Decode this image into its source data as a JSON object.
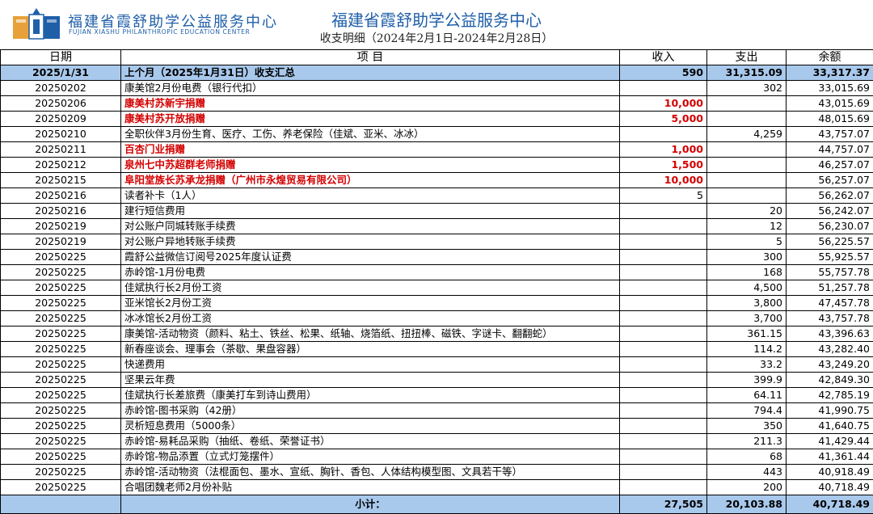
{
  "header": {
    "org_name_cn": "福建省霞舒助学公益服务中心",
    "org_name_en": "FUJIAN XIASHU PHILANTHROPIC EDUCATION CENTER",
    "title": "福建省霞舒助学公益服务中心",
    "subtitle": "收支明细（2024年2月1日-2024年2月28日）"
  },
  "table": {
    "columns": [
      "日期",
      "项  目",
      "收入",
      "支出",
      "余额"
    ],
    "summary": {
      "date": "2025/1/31",
      "item": "上个月（2025年1月31日）收支汇总",
      "income": "590",
      "expense": "31,315.09",
      "balance": "33,317.37"
    },
    "rows": [
      {
        "date": "20250202",
        "item": "康美馆2月份电费（银行代扣）",
        "income": "",
        "expense": "302",
        "balance": "33,015.69",
        "donation": false
      },
      {
        "date": "20250206",
        "item": "康美村苏新宇捐赠",
        "income": "10,000",
        "expense": "",
        "balance": "43,015.69",
        "donation": true
      },
      {
        "date": "20250209",
        "item": "康美村苏开放捐赠",
        "income": "5,000",
        "expense": "",
        "balance": "48,015.69",
        "donation": true
      },
      {
        "date": "20250210",
        "item": "全职伙伴3月份生育、医疗、工伤、养老保险（佳斌、亚米、冰冰）",
        "income": "",
        "expense": "4,259",
        "balance": "43,757.07",
        "donation": false
      },
      {
        "date": "20250211",
        "item": "百杏门业捐赠",
        "income": "1,000",
        "expense": "",
        "balance": "44,757.07",
        "donation": true
      },
      {
        "date": "20250212",
        "item": "泉州七中苏超群老师捐赠",
        "income": "1,500",
        "expense": "",
        "balance": "46,257.07",
        "donation": true
      },
      {
        "date": "20250215",
        "item": "阜阳堂族长苏承龙捐赠（广州市永煌贸易有限公司）",
        "income": "10,000",
        "expense": "",
        "balance": "56,257.07",
        "donation": true
      },
      {
        "date": "20250216",
        "item": "读者补卡（1人）",
        "income": "5",
        "expense": "",
        "balance": "56,262.07",
        "donation": false
      },
      {
        "date": "20250216",
        "item": "建行短信费用",
        "income": "",
        "expense": "20",
        "balance": "56,242.07",
        "donation": false
      },
      {
        "date": "20250219",
        "item": "对公账户同城转账手续费",
        "income": "",
        "expense": "12",
        "balance": "56,230.07",
        "donation": false
      },
      {
        "date": "20250219",
        "item": "对公账户异地转账手续费",
        "income": "",
        "expense": "5",
        "balance": "56,225.57",
        "donation": false
      },
      {
        "date": "20250225",
        "item": "霞舒公益微信订阅号2025年度认证费",
        "income": "",
        "expense": "300",
        "balance": "55,925.57",
        "donation": false
      },
      {
        "date": "20250225",
        "item": "赤岭馆-1月份电费",
        "income": "",
        "expense": "168",
        "balance": "55,757.78",
        "donation": false
      },
      {
        "date": "20250225",
        "item": "佳斌执行长2月份工资",
        "income": "",
        "expense": "4,500",
        "balance": "51,257.78",
        "donation": false
      },
      {
        "date": "20250225",
        "item": "亚米馆长2月份工资",
        "income": "",
        "expense": "3,800",
        "balance": "47,457.78",
        "donation": false
      },
      {
        "date": "20250225",
        "item": "冰冰馆长2月份工资",
        "income": "",
        "expense": "3,700",
        "balance": "43,757.78",
        "donation": false
      },
      {
        "date": "20250225",
        "item": "康美馆-活动物资（颜料、粘土、铁丝、松果、纸轴、烧箔纸、扭扭棒、磁铁、字谜卡、翻翻蛇）",
        "income": "",
        "expense": "361.15",
        "balance": "43,396.63",
        "donation": false
      },
      {
        "date": "20250225",
        "item": "新春座谈会、理事会（茶歇、果盘容器）",
        "income": "",
        "expense": "114.2",
        "balance": "43,282.40",
        "donation": false
      },
      {
        "date": "20250225",
        "item": "快递费用",
        "income": "",
        "expense": "33.2",
        "balance": "43,249.20",
        "donation": false
      },
      {
        "date": "20250225",
        "item": "坚果云年费",
        "income": "",
        "expense": "399.9",
        "balance": "42,849.30",
        "donation": false
      },
      {
        "date": "20250225",
        "item": "佳斌执行长差旅费（康美打车到诗山费用）",
        "income": "",
        "expense": "64.11",
        "balance": "42,785.19",
        "donation": false
      },
      {
        "date": "20250225",
        "item": "赤岭馆-图书采购（42册）",
        "income": "",
        "expense": "794.4",
        "balance": "41,990.75",
        "donation": false
      },
      {
        "date": "20250225",
        "item": "灵析短息费用（5000条）",
        "income": "",
        "expense": "350",
        "balance": "41,640.75",
        "donation": false
      },
      {
        "date": "20250225",
        "item": "赤岭馆-易耗品采购（抽纸、卷纸、荣誉证书）",
        "income": "",
        "expense": "211.3",
        "balance": "41,429.44",
        "donation": false
      },
      {
        "date": "20250225",
        "item": "赤岭馆-物品添置（立式灯笼摆件）",
        "income": "",
        "expense": "68",
        "balance": "41,361.44",
        "donation": false
      },
      {
        "date": "20250225",
        "item": "赤岭馆-活动物资（法棍面包、墨水、宣纸、胸针、香包、人体结构模型图、文具若干等）",
        "income": "",
        "expense": "443",
        "balance": "40,918.49",
        "donation": false
      },
      {
        "date": "20250225",
        "item": "合唱团魏老师2月份补贴",
        "income": "",
        "expense": "200",
        "balance": "40,718.49",
        "donation": false
      }
    ],
    "total": {
      "label": "小计：",
      "income": "27,505",
      "expense": "20,103.88",
      "balance": "40,718.49"
    }
  },
  "colors": {
    "header_fill": "#a9c9ec",
    "donation_text": "#d40000",
    "brand_blue": "#1f5fa8"
  }
}
